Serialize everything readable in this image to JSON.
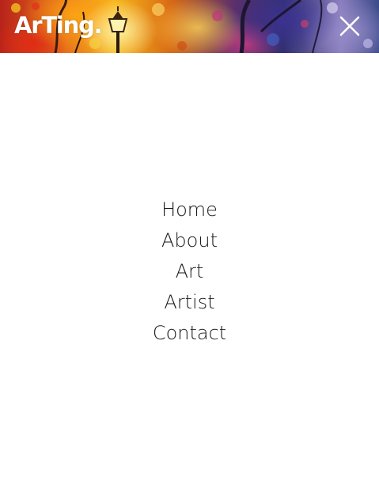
{
  "header": {
    "logo_text": "ArTing."
  },
  "icons": {
    "close": "close-icon",
    "background": "painting-banner"
  },
  "colors": {
    "nav_text": "#1a1a1a",
    "background": "#ffffff",
    "logo": "#ffffff"
  },
  "nav": {
    "items": [
      {
        "label": "Home"
      },
      {
        "label": "About"
      },
      {
        "label": "Art"
      },
      {
        "label": "Artist"
      },
      {
        "label": "Contact"
      }
    ]
  }
}
